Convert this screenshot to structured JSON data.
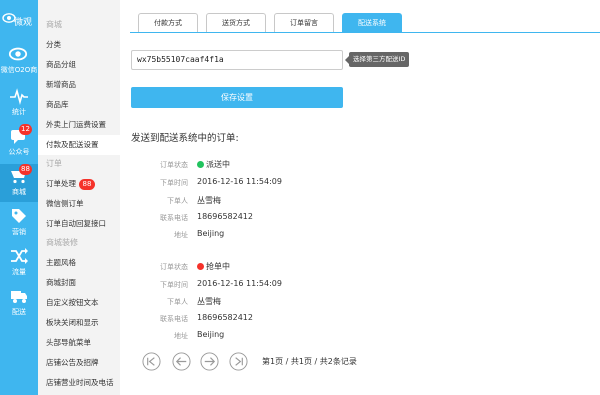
{
  "brand": {
    "name": "微观"
  },
  "rail": [
    {
      "name": "微信O2O商",
      "icon": "eye-icon"
    },
    {
      "name": "统计",
      "icon": "pulse-icon"
    },
    {
      "name": "公众号",
      "icon": "chat-icon",
      "badge": "12"
    },
    {
      "name": "商城",
      "icon": "cart-icon",
      "badge": "88"
    },
    {
      "name": "营销",
      "icon": "tag-icon"
    },
    {
      "name": "流量",
      "icon": "shuffle-icon"
    },
    {
      "name": "配送",
      "icon": "delivery-icon"
    }
  ],
  "menu": {
    "group_mall": "商城",
    "items_mall": [
      "分类",
      "商品分组",
      "新增商品",
      "商品库",
      "外卖上门运费设置",
      "付款及配送设置"
    ],
    "group_order": "订单",
    "order_process": "订单处理",
    "order_badge": "88",
    "items_order": [
      "微信侧订单",
      "订单自动回复接口"
    ],
    "group_decor": "商城装修",
    "items_decor": [
      "主题风格",
      "商城封面",
      "自定义按钮文本",
      "板块关闭和显示",
      "头部导航菜单",
      "店铺公告及招牌",
      "店铺营业时间及电话"
    ]
  },
  "tabs": [
    "付款方式",
    "送货方式",
    "订单留言",
    "配送系统"
  ],
  "config": {
    "id_value": "wx75b55107caaf4f1a",
    "id_tip": "选择第三方配送ID",
    "save_label": "保存设置"
  },
  "orders_title": "发送到配送系统中的订单:",
  "labels": {
    "status": "订单状态",
    "time": "下单时间",
    "person": "下单人",
    "phone": "联系电话",
    "address": "地址"
  },
  "orders": [
    {
      "status": "派送中",
      "status_color": "#22c35e",
      "time": "2016-12-16 11:54:09",
      "person": "丛雪梅",
      "phone": "18696582412",
      "address": "Beijing"
    },
    {
      "status": "抢单中",
      "status_color": "#f5322a",
      "time": "2016-12-16 11:54:09",
      "person": "丛雪梅",
      "phone": "18696582412",
      "address": "Beijing"
    }
  ],
  "pagination": {
    "info": "第1页 / 共1页 / 共2条记录"
  },
  "colors": {
    "accent": "#3fb6ef",
    "menu_bg": "#f3f3f3",
    "badge": "#f5322a"
  }
}
